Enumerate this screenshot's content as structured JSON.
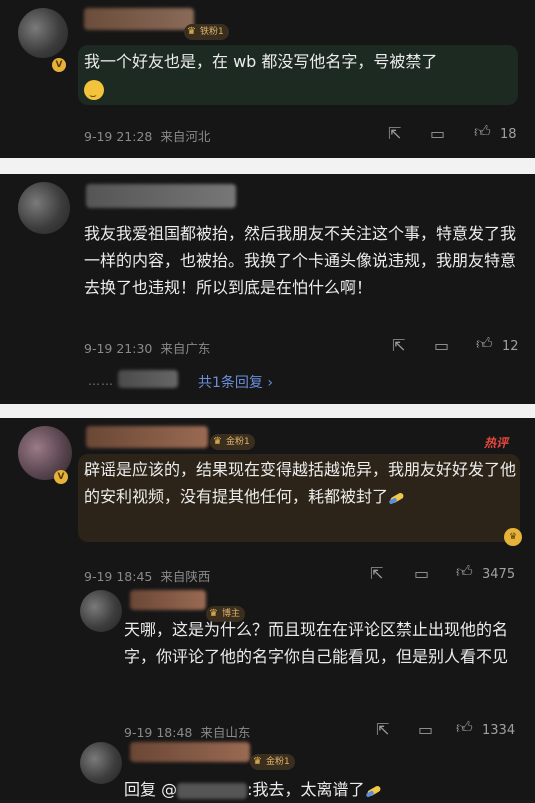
{
  "comments": [
    {
      "badge": "铁粉1",
      "text": "我一个好友也是，在 wb 都没写他名字，号被禁了",
      "time": "9-19 21:28",
      "location": "来自河北",
      "likes": "18"
    },
    {
      "text": "我友我爱祖国都被抬，然后我朋友不关注这个事，特意发了我一样的内容，也被抬。我换了个卡通头像说违规，我朋友特意去换了也违规！所以到底是在怕什么啊！",
      "time": "9-19 21:30",
      "location": "来自广东",
      "likes": "12",
      "replies_link": "共1条回复 ›"
    },
    {
      "badge": "金粉1",
      "hot_label": "热评",
      "text": "辟谣是应该的，结果现在变得越括越诡异，我朋友好好发了他的安利视频，没有提其他任何，耗都被封了",
      "time": "9-19 18:45",
      "location": "来自陕西",
      "likes": "3475"
    },
    {
      "badge": "博主",
      "text": "天哪，这是为什么？而且现在在评论区禁止出现他的名字，你评论了他的名字你自己能看见，但是别人看不见",
      "time": "9-19 18:48",
      "location": "来自山东",
      "likes": "1334"
    },
    {
      "badge": "金粉1",
      "reply_prefix": "回复 @",
      "reply_text": ":我去，太离谱了"
    }
  ],
  "icons": {
    "share": "share-icon",
    "comment": "comment-icon",
    "like": "thumbs-up-icon"
  }
}
